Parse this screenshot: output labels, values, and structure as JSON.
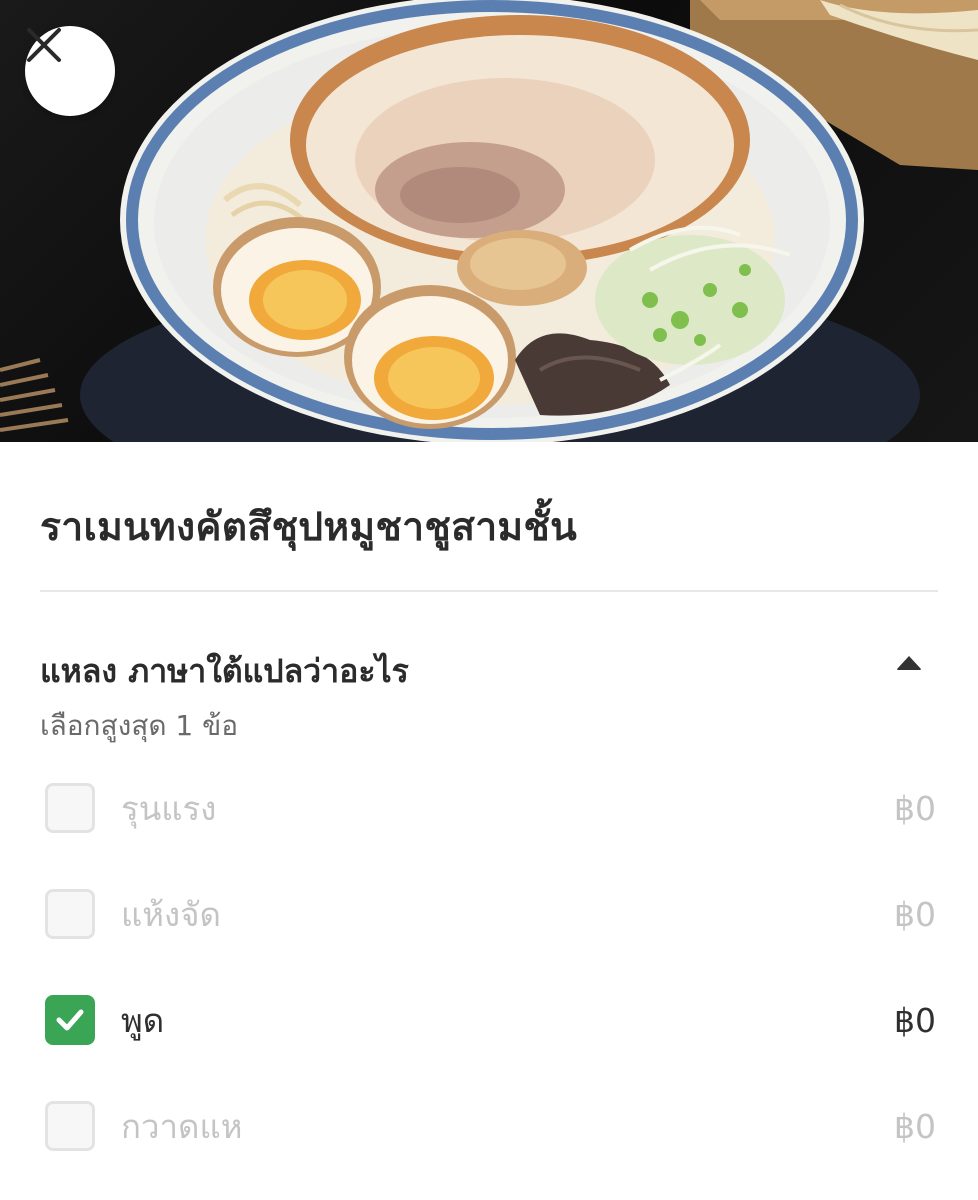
{
  "item": {
    "title": "ราเมนทงคัตสึชุปหมูชาชูสามชั้น"
  },
  "option_group": {
    "title": "แหลง ภาษาใต้แปลว่าอะไร",
    "subtitle": "เลือกสูงสุด 1 ข้อ",
    "options": [
      {
        "label": "รุนแรง",
        "price": "฿0",
        "checked": false
      },
      {
        "label": "แห้งจัด",
        "price": "฿0",
        "checked": false
      },
      {
        "label": "พูด",
        "price": "฿0",
        "checked": true
      },
      {
        "label": "กวาดแห",
        "price": "฿0",
        "checked": false
      }
    ]
  },
  "colors": {
    "accent_green": "#3aa655",
    "text_primary": "#2b2b2b",
    "text_disabled": "#c4c4c4"
  },
  "icons": {
    "close": "close-icon",
    "collapse": "caret-up-icon",
    "check": "check-icon"
  }
}
